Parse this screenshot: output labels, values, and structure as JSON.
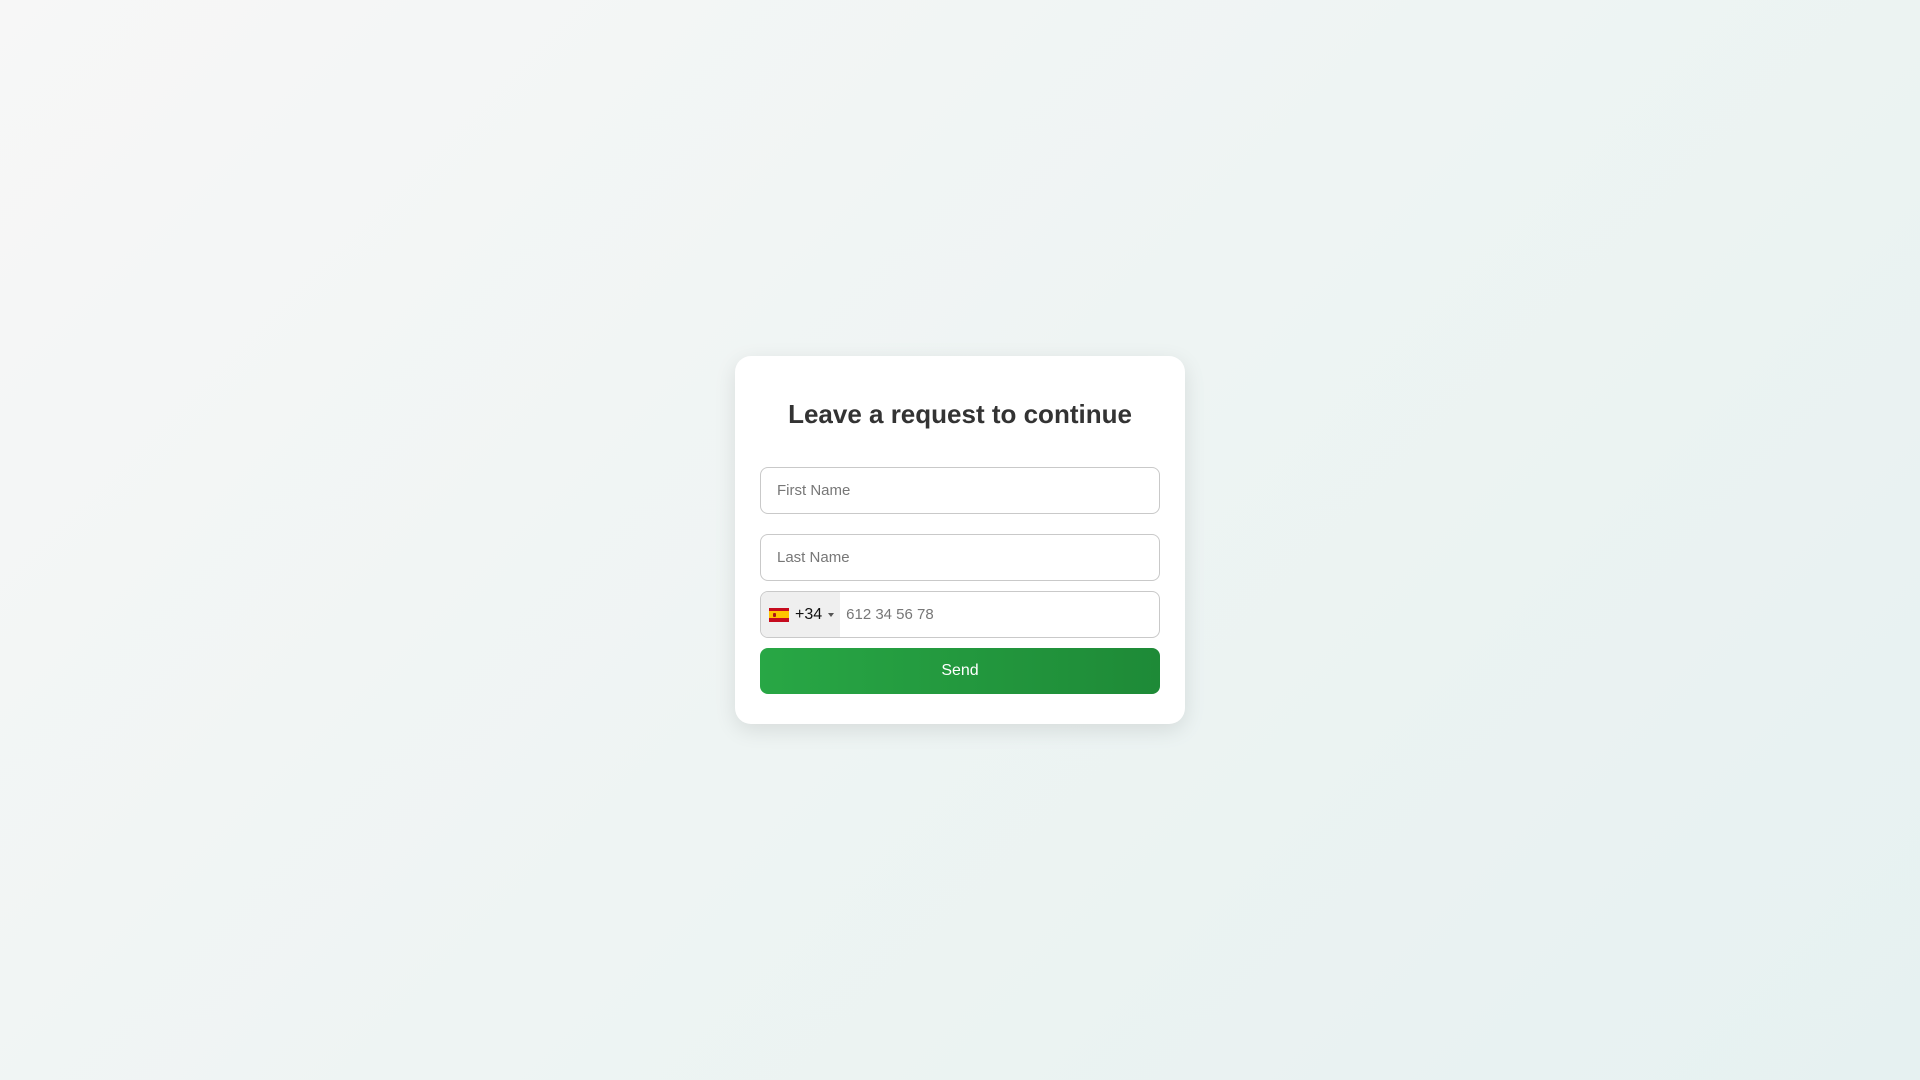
{
  "form": {
    "title": "Leave a request to continue",
    "first_name": {
      "placeholder": "First Name",
      "value": ""
    },
    "last_name": {
      "placeholder": "Last Name",
      "value": ""
    },
    "phone": {
      "country_flag_icon": "spain-flag-icon",
      "dial_code": "+34",
      "placeholder": "612 34 56 78",
      "value": ""
    },
    "submit_label": "Send"
  },
  "colors": {
    "accent_start": "#28a745",
    "accent_end": "#1e8a37",
    "title": "#333333",
    "card": "#ffffff"
  }
}
